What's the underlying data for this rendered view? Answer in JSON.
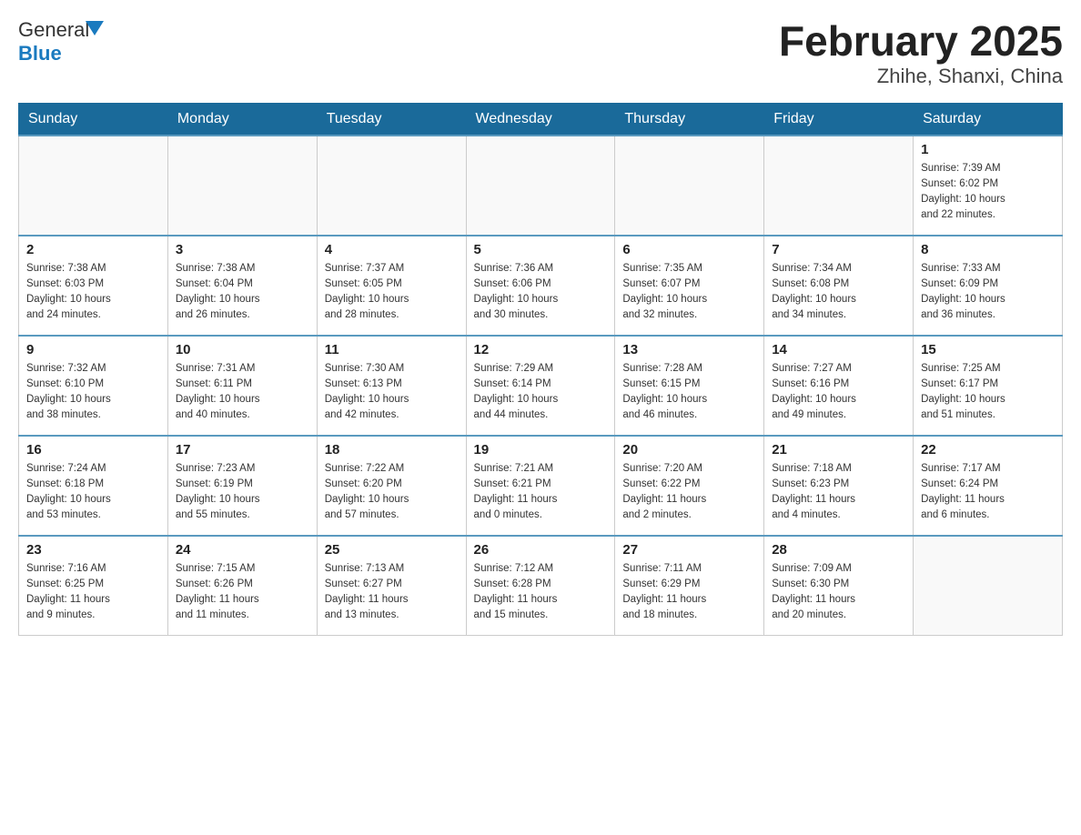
{
  "logo": {
    "text_general": "General",
    "text_blue": "Blue"
  },
  "title": "February 2025",
  "subtitle": "Zhihe, Shanxi, China",
  "days_of_week": [
    "Sunday",
    "Monday",
    "Tuesday",
    "Wednesday",
    "Thursday",
    "Friday",
    "Saturday"
  ],
  "weeks": [
    [
      {
        "day": "",
        "info": ""
      },
      {
        "day": "",
        "info": ""
      },
      {
        "day": "",
        "info": ""
      },
      {
        "day": "",
        "info": ""
      },
      {
        "day": "",
        "info": ""
      },
      {
        "day": "",
        "info": ""
      },
      {
        "day": "1",
        "info": "Sunrise: 7:39 AM\nSunset: 6:02 PM\nDaylight: 10 hours\nand 22 minutes."
      }
    ],
    [
      {
        "day": "2",
        "info": "Sunrise: 7:38 AM\nSunset: 6:03 PM\nDaylight: 10 hours\nand 24 minutes."
      },
      {
        "day": "3",
        "info": "Sunrise: 7:38 AM\nSunset: 6:04 PM\nDaylight: 10 hours\nand 26 minutes."
      },
      {
        "day": "4",
        "info": "Sunrise: 7:37 AM\nSunset: 6:05 PM\nDaylight: 10 hours\nand 28 minutes."
      },
      {
        "day": "5",
        "info": "Sunrise: 7:36 AM\nSunset: 6:06 PM\nDaylight: 10 hours\nand 30 minutes."
      },
      {
        "day": "6",
        "info": "Sunrise: 7:35 AM\nSunset: 6:07 PM\nDaylight: 10 hours\nand 32 minutes."
      },
      {
        "day": "7",
        "info": "Sunrise: 7:34 AM\nSunset: 6:08 PM\nDaylight: 10 hours\nand 34 minutes."
      },
      {
        "day": "8",
        "info": "Sunrise: 7:33 AM\nSunset: 6:09 PM\nDaylight: 10 hours\nand 36 minutes."
      }
    ],
    [
      {
        "day": "9",
        "info": "Sunrise: 7:32 AM\nSunset: 6:10 PM\nDaylight: 10 hours\nand 38 minutes."
      },
      {
        "day": "10",
        "info": "Sunrise: 7:31 AM\nSunset: 6:11 PM\nDaylight: 10 hours\nand 40 minutes."
      },
      {
        "day": "11",
        "info": "Sunrise: 7:30 AM\nSunset: 6:13 PM\nDaylight: 10 hours\nand 42 minutes."
      },
      {
        "day": "12",
        "info": "Sunrise: 7:29 AM\nSunset: 6:14 PM\nDaylight: 10 hours\nand 44 minutes."
      },
      {
        "day": "13",
        "info": "Sunrise: 7:28 AM\nSunset: 6:15 PM\nDaylight: 10 hours\nand 46 minutes."
      },
      {
        "day": "14",
        "info": "Sunrise: 7:27 AM\nSunset: 6:16 PM\nDaylight: 10 hours\nand 49 minutes."
      },
      {
        "day": "15",
        "info": "Sunrise: 7:25 AM\nSunset: 6:17 PM\nDaylight: 10 hours\nand 51 minutes."
      }
    ],
    [
      {
        "day": "16",
        "info": "Sunrise: 7:24 AM\nSunset: 6:18 PM\nDaylight: 10 hours\nand 53 minutes."
      },
      {
        "day": "17",
        "info": "Sunrise: 7:23 AM\nSunset: 6:19 PM\nDaylight: 10 hours\nand 55 minutes."
      },
      {
        "day": "18",
        "info": "Sunrise: 7:22 AM\nSunset: 6:20 PM\nDaylight: 10 hours\nand 57 minutes."
      },
      {
        "day": "19",
        "info": "Sunrise: 7:21 AM\nSunset: 6:21 PM\nDaylight: 11 hours\nand 0 minutes."
      },
      {
        "day": "20",
        "info": "Sunrise: 7:20 AM\nSunset: 6:22 PM\nDaylight: 11 hours\nand 2 minutes."
      },
      {
        "day": "21",
        "info": "Sunrise: 7:18 AM\nSunset: 6:23 PM\nDaylight: 11 hours\nand 4 minutes."
      },
      {
        "day": "22",
        "info": "Sunrise: 7:17 AM\nSunset: 6:24 PM\nDaylight: 11 hours\nand 6 minutes."
      }
    ],
    [
      {
        "day": "23",
        "info": "Sunrise: 7:16 AM\nSunset: 6:25 PM\nDaylight: 11 hours\nand 9 minutes."
      },
      {
        "day": "24",
        "info": "Sunrise: 7:15 AM\nSunset: 6:26 PM\nDaylight: 11 hours\nand 11 minutes."
      },
      {
        "day": "25",
        "info": "Sunrise: 7:13 AM\nSunset: 6:27 PM\nDaylight: 11 hours\nand 13 minutes."
      },
      {
        "day": "26",
        "info": "Sunrise: 7:12 AM\nSunset: 6:28 PM\nDaylight: 11 hours\nand 15 minutes."
      },
      {
        "day": "27",
        "info": "Sunrise: 7:11 AM\nSunset: 6:29 PM\nDaylight: 11 hours\nand 18 minutes."
      },
      {
        "day": "28",
        "info": "Sunrise: 7:09 AM\nSunset: 6:30 PM\nDaylight: 11 hours\nand 20 minutes."
      },
      {
        "day": "",
        "info": ""
      }
    ]
  ]
}
